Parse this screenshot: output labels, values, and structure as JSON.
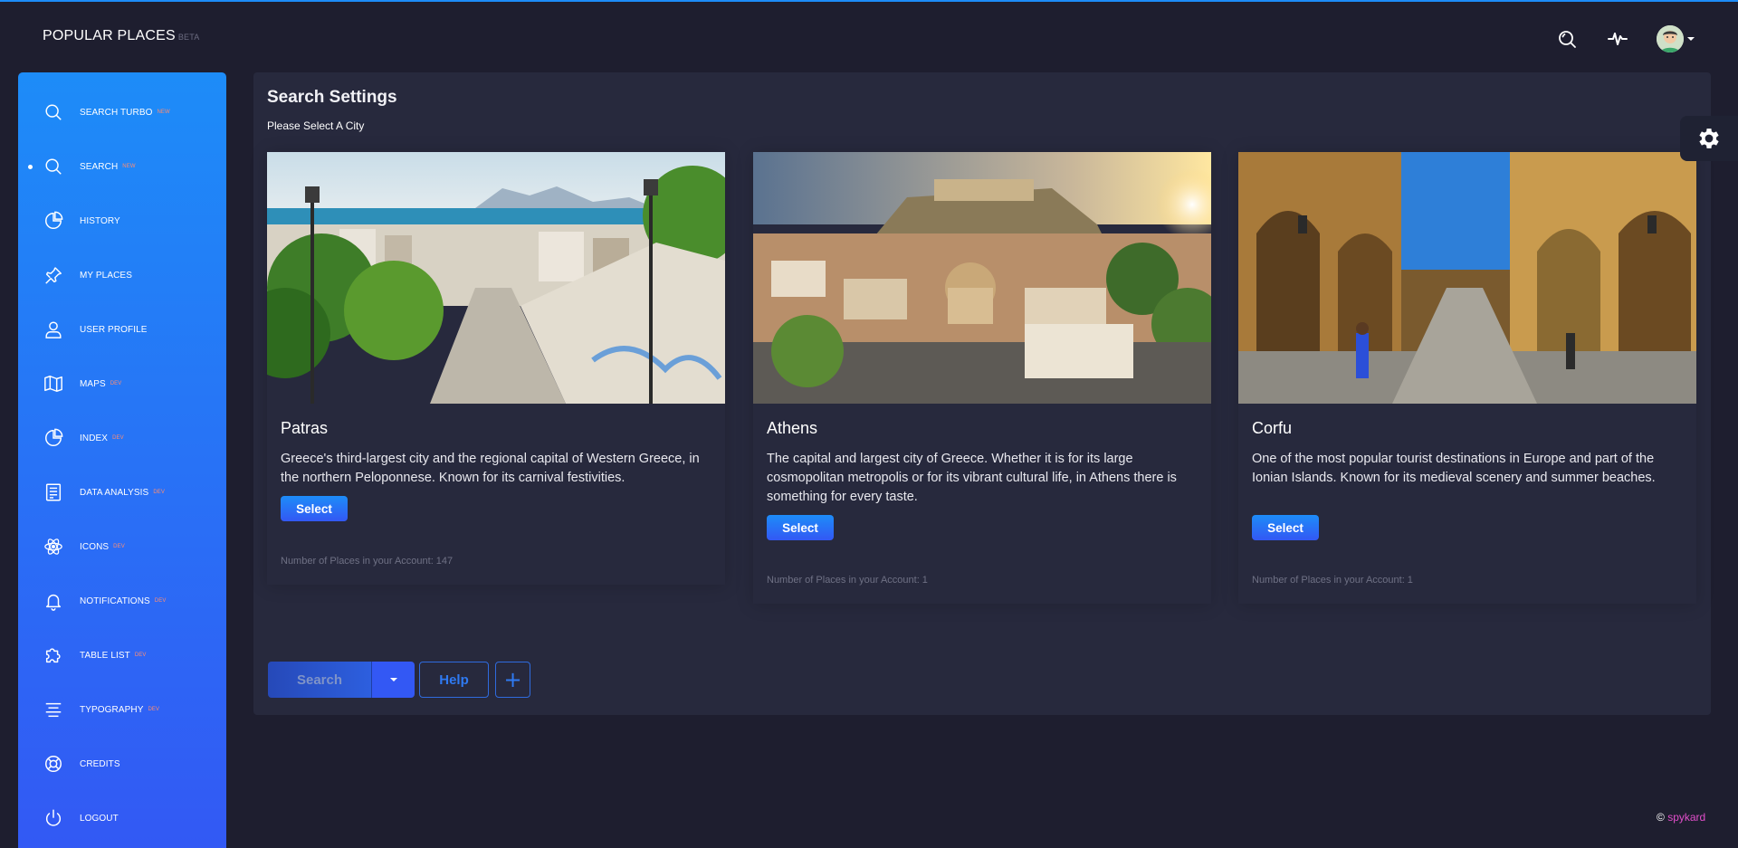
{
  "brand": {
    "title": "POPULAR PLACES",
    "badge": "BETA"
  },
  "sidebar": {
    "items": [
      {
        "label": "SEARCH TURBO",
        "tag": "NEW",
        "icon": "search-icon"
      },
      {
        "label": "SEARCH",
        "tag": "NEW",
        "icon": "search-icon",
        "active": true
      },
      {
        "label": "HISTORY",
        "tag": "",
        "icon": "chart-pie-icon"
      },
      {
        "label": "MY PLACES",
        "tag": "",
        "icon": "pin-icon"
      },
      {
        "label": "USER PROFILE",
        "tag": "",
        "icon": "user-icon"
      },
      {
        "label": "MAPS",
        "tag": "DEV",
        "icon": "map-icon"
      },
      {
        "label": "INDEX",
        "tag": "DEV",
        "icon": "chart-pie-icon"
      },
      {
        "label": "DATA ANALYSIS",
        "tag": "DEV",
        "icon": "document-icon"
      },
      {
        "label": "ICONS",
        "tag": "DEV",
        "icon": "atom-icon"
      },
      {
        "label": "NOTIFICATIONS",
        "tag": "DEV",
        "icon": "bell-icon"
      },
      {
        "label": "TABLE LIST",
        "tag": "DEV",
        "icon": "puzzle-icon"
      },
      {
        "label": "TYPOGRAPHY",
        "tag": "DEV",
        "icon": "align-center-icon"
      },
      {
        "label": "CREDITS",
        "tag": "",
        "icon": "lifebuoy-icon"
      },
      {
        "label": "LOGOUT",
        "tag": "",
        "icon": "power-icon"
      }
    ]
  },
  "main": {
    "title": "Search Settings",
    "subtitle": "Please Select A City",
    "cities": [
      {
        "name": "Patras",
        "description": "Greece's third-largest city and the regional capital of Western Greece, in the northern Peloponnese. Known for its carnival festivities.",
        "button": "Select",
        "count": "Number of Places in your Account: 147"
      },
      {
        "name": "Athens",
        "description": "The capital and largest city of Greece. Whether it is for its large cosmopolitan metropolis or for its vibrant cultural life, in Athens there is something for every taste.",
        "button": "Select",
        "count": "Number of Places in your Account: 1"
      },
      {
        "name": "Corfu",
        "description": "One of the most popular tourist destinations in Europe and part of the Ionian Islands. Known for its medieval scenery and summer beaches.",
        "button": "Select",
        "count": "Number of Places in your Account: 1"
      }
    ],
    "actions": {
      "search": "Search",
      "help": "Help",
      "plus": "+"
    }
  },
  "footer": {
    "copy": "©",
    "brand": "spykard"
  },
  "colors": {
    "accent": "#1d8cf8",
    "accent2": "#3358f4",
    "bg": "#1e1e2f",
    "card": "#27293d",
    "footer_brand": "#e14eca"
  }
}
